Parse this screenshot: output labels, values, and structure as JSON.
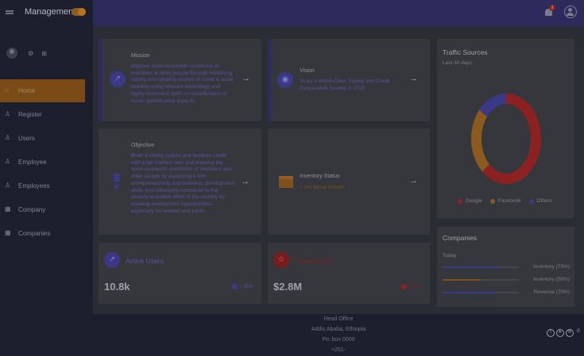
{
  "app": {
    "title": "Management"
  },
  "sidebar": {
    "profile_actions": "⚙ ⊞",
    "items": [
      {
        "label": "Home",
        "icon": "home-icon",
        "glyph": "⌂",
        "active": true
      },
      {
        "label": "Register",
        "icon": "person-add-icon",
        "glyph": "♙",
        "active": false
      },
      {
        "label": "Users",
        "icon": "person-icon",
        "glyph": "♙",
        "active": false
      },
      {
        "label": "Employee",
        "icon": "person-add-icon",
        "glyph": "♙",
        "active": false
      },
      {
        "label": "Employees",
        "icon": "group-icon",
        "glyph": "♙",
        "active": false
      },
      {
        "label": "Company",
        "icon": "building-icon",
        "glyph": "▦",
        "active": false
      },
      {
        "label": "Companies",
        "icon": "building-icon",
        "glyph": "▦",
        "active": false
      }
    ]
  },
  "topbar": {
    "notification_count": "3"
  },
  "mission": {
    "label": "Mission",
    "lines": [
      "Improve socio-economic conditions of",
      "members & other people through mobilizing",
      "saving and creating access of credit & asset",
      "building using relevant technology and",
      "highly motivated staffs in consideration of",
      "socio- gender-wise aspects."
    ]
  },
  "vision": {
    "label": "Vision",
    "lines": [
      "To be a World-Class Saving and Credit",
      "Cooperative Society in 2030"
    ]
  },
  "objective": {
    "label": "Objective",
    "lines": [
      "Build a saving culture and facilitate credit",
      "with a fair interest rate; and improve the",
      "socio-economic conditions of members and",
      "other people by equipping it with",
      "entrepreneurship and business development",
      "skills. And effectively contribute to the",
      "poverty reduction effort of the country by",
      "creating employment opportunities,",
      "especially for women and youth."
    ]
  },
  "inventory": {
    "label": "Inventory Status",
    "value": "+ 2% Stock Growth"
  },
  "stats": {
    "active_users": {
      "title": "Active Users",
      "value": "10.8k",
      "change": "+ 25%"
    },
    "transactions": {
      "title": "Transactions",
      "value": "$2.8M",
      "change": "- 55%"
    }
  },
  "traffic": {
    "title": "Traffic Sources",
    "subtitle": "Last 30 days",
    "legend": [
      {
        "label": "Google",
        "color": "#8c2121"
      },
      {
        "label": "Facebook",
        "color": "#8a5a1e"
      },
      {
        "label": "Others",
        "color": "#3b3987"
      }
    ]
  },
  "chart_data": {
    "type": "pie",
    "title": "Traffic Sources",
    "subtitle": "Last 30 days",
    "categories": [
      "Google",
      "Facebook",
      "Others"
    ],
    "values": [
      62,
      24,
      14
    ],
    "colors": [
      "#8c2121",
      "#8a5a1e",
      "#3b3987"
    ]
  },
  "companies": {
    "title": "Companies",
    "period": "Today",
    "rows": [
      {
        "name": "Inventory (73%)",
        "fill": 0.73,
        "color": "#3b3987"
      },
      {
        "name": "Inventory (50%)",
        "fill": 0.5,
        "color": "#80501f"
      },
      {
        "name": "Revenue (70%)",
        "fill": 0.7,
        "color": "#3b3987"
      }
    ]
  },
  "footer": {
    "lines": [
      "Head Office",
      "Addis Ababa, Ethiopia",
      "Po. box 0000",
      "+251-"
    ]
  }
}
